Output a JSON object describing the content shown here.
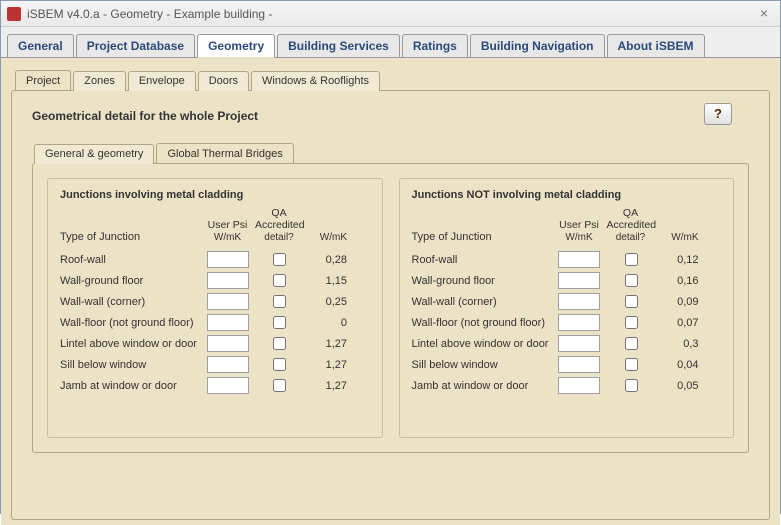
{
  "window": {
    "title": "iSBEM v4.0.a - Geometry - Example building -",
    "close_glyph": "×"
  },
  "main_tabs": [
    "General",
    "Project Database",
    "Geometry",
    "Building Services",
    "Ratings",
    "Building Navigation",
    "About iSBEM"
  ],
  "main_tab_active": 2,
  "sub_tabs": [
    "Project",
    "Zones",
    "Envelope",
    "Doors",
    "Windows & Rooflights"
  ],
  "sub_tab_active": 0,
  "panel_title": "Geometrical detail for the whole Project",
  "help_glyph": "?",
  "inner_tabs": [
    "General & geometry",
    "Global Thermal Bridges"
  ],
  "inner_tab_active": 1,
  "col_headers": {
    "type": "Type of Junction",
    "user_psi": "User Psi",
    "user_psi_unit": "W/mK",
    "qa": "QA Accredited",
    "qa2": "detail?",
    "wmk": "W/mK"
  },
  "group_left": {
    "title": "Junctions involving metal cladding",
    "rows": [
      {
        "label": "Roof-wall",
        "psi": "",
        "qa": false,
        "wmk": "0,28"
      },
      {
        "label": "Wall-ground floor",
        "psi": "",
        "qa": false,
        "wmk": "1,15"
      },
      {
        "label": "Wall-wall (corner)",
        "psi": "",
        "qa": false,
        "wmk": "0,25"
      },
      {
        "label": "Wall-floor (not ground floor)",
        "psi": "",
        "qa": false,
        "wmk": "0"
      },
      {
        "label": "Lintel above window or door",
        "psi": "",
        "qa": false,
        "wmk": "1,27"
      },
      {
        "label": "Sill below window",
        "psi": "",
        "qa": false,
        "wmk": "1,27"
      },
      {
        "label": "Jamb at window or door",
        "psi": "",
        "qa": false,
        "wmk": "1,27"
      }
    ]
  },
  "group_right": {
    "title": "Junctions NOT involving metal cladding",
    "rows": [
      {
        "label": "Roof-wall",
        "psi": "",
        "qa": false,
        "wmk": "0,12"
      },
      {
        "label": "Wall-ground floor",
        "psi": "",
        "qa": false,
        "wmk": "0,16"
      },
      {
        "label": "Wall-wall (corner)",
        "psi": "",
        "qa": false,
        "wmk": "0,09"
      },
      {
        "label": "Wall-floor (not ground floor)",
        "psi": "",
        "qa": false,
        "wmk": "0,07"
      },
      {
        "label": "Lintel above window or door",
        "psi": "",
        "qa": false,
        "wmk": "0,3"
      },
      {
        "label": "Sill below window",
        "psi": "",
        "qa": false,
        "wmk": "0,04"
      },
      {
        "label": "Jamb at window or door",
        "psi": "",
        "qa": false,
        "wmk": "0,05"
      }
    ]
  }
}
